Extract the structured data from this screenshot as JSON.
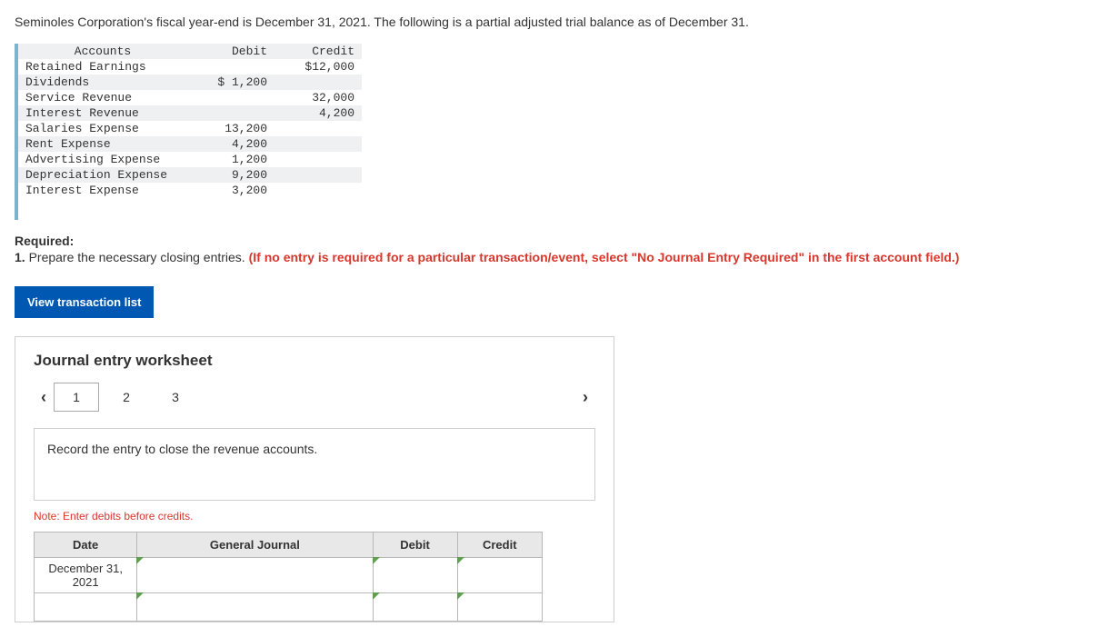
{
  "intro": "Seminoles Corporation's fiscal year-end is December 31, 2021. The following is a partial adjusted trial balance as of December 31.",
  "trial_balance": {
    "headers": {
      "accounts": "Accounts",
      "debit": "Debit",
      "credit": "Credit"
    },
    "rows": [
      {
        "account": "Retained Earnings",
        "debit": "",
        "credit": "$12,000"
      },
      {
        "account": "Dividends",
        "debit": "$ 1,200",
        "credit": ""
      },
      {
        "account": "Service Revenue",
        "debit": "",
        "credit": "32,000"
      },
      {
        "account": "Interest Revenue",
        "debit": "",
        "credit": "4,200"
      },
      {
        "account": "Salaries Expense",
        "debit": "13,200",
        "credit": ""
      },
      {
        "account": "Rent Expense",
        "debit": "4,200",
        "credit": ""
      },
      {
        "account": "Advertising Expense",
        "debit": "1,200",
        "credit": ""
      },
      {
        "account": "Depreciation Expense",
        "debit": "9,200",
        "credit": ""
      },
      {
        "account": "Interest Expense",
        "debit": "3,200",
        "credit": ""
      }
    ]
  },
  "required": {
    "heading": "Required:",
    "num": "1.",
    "text": " Prepare the necessary closing entries. ",
    "red": "(If no entry is required for a particular transaction/event, select \"No Journal Entry Required\" in the first account field.)"
  },
  "view_btn": "View transaction list",
  "worksheet": {
    "title": "Journal entry worksheet",
    "tabs": [
      "1",
      "2",
      "3"
    ],
    "active_tab": 0,
    "instruction": "Record the entry to close the revenue accounts.",
    "note": "Note: Enter debits before credits.",
    "table": {
      "headers": {
        "date": "Date",
        "gj": "General Journal",
        "debit": "Debit",
        "credit": "Credit"
      },
      "rows": [
        {
          "date": "December 31, 2021",
          "gj": "",
          "debit": "",
          "credit": ""
        },
        {
          "date": "",
          "gj": "",
          "debit": "",
          "credit": ""
        }
      ]
    }
  }
}
